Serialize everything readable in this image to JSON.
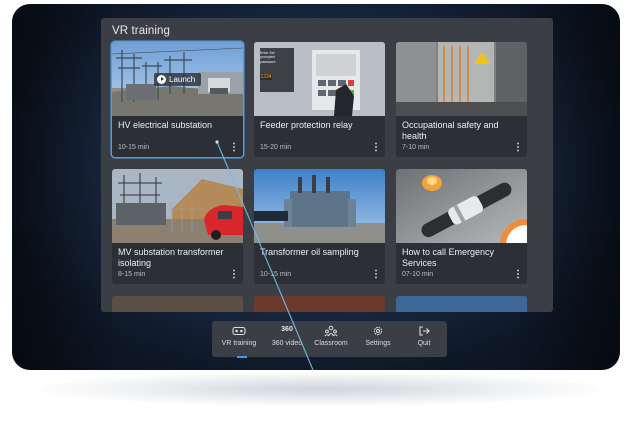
{
  "panel": {
    "title": "VR training"
  },
  "cards": [
    {
      "title": "HV electrical substation",
      "duration": "10-15 min",
      "menu": "⋮",
      "launch_label": "Launch",
      "selected": true
    },
    {
      "title": "Feeder protection relay",
      "duration": "15-20 min",
      "menu": "⋮"
    },
    {
      "title": "Occupational safety and health",
      "duration": "7-10 min",
      "menu": "⋮"
    },
    {
      "title": "MV substation transformer isolating",
      "duration": "8-15 min",
      "menu": "⋮"
    },
    {
      "title": "Transformer oil sampling",
      "duration": "10-15 min",
      "menu": "⋮"
    },
    {
      "title": "How to call Emergency Services",
      "duration": "07-10 min",
      "menu": "⋮"
    }
  ],
  "thumb_text": {
    "relay_screen": "Enter the prompted password",
    "relay_code": "1234"
  },
  "navbar": {
    "items": [
      {
        "label": "VR training",
        "icon": "vr-headset-icon",
        "active": true
      },
      {
        "label": "360 video",
        "icon": "360-icon",
        "icon_text": "360"
      },
      {
        "label": "Classroom",
        "icon": "classroom-icon"
      },
      {
        "label": "Settings",
        "icon": "gear-icon"
      },
      {
        "label": "Quit",
        "icon": "quit-icon"
      }
    ]
  },
  "colors": {
    "accent": "#3b9ae8",
    "panel": "#3b3f45",
    "card": "#2c3036",
    "pointer_ray": "#5fb0e0"
  }
}
